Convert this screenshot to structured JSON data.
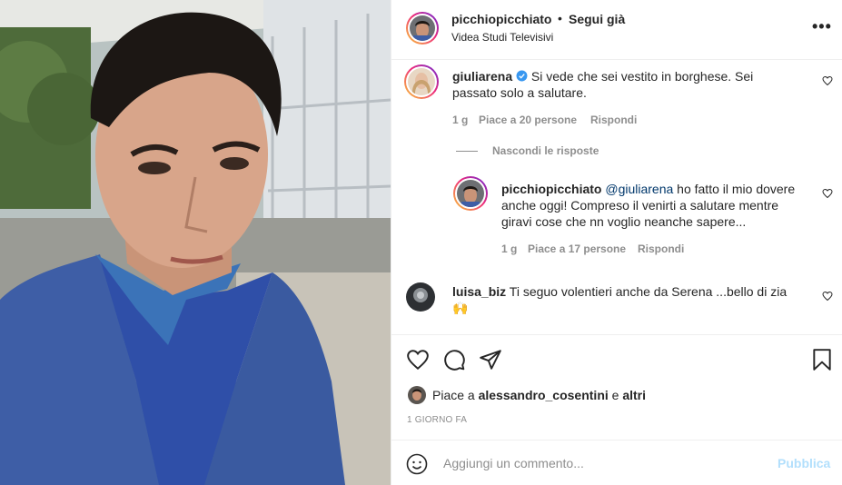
{
  "header": {
    "username": "picchiopicchiato",
    "dot": "•",
    "follow_label": "Segui già",
    "location": "Videa Studi Televisivi",
    "more": "•••"
  },
  "comments": [
    {
      "username": "giuliarena",
      "verified": true,
      "text_line1": "Si vede che sei vestito in borghese. Sei",
      "text_line2": "passato solo a salutare.",
      "time": "1 g",
      "likes": "Piace a 20 persone",
      "reply": "Rispondi"
    }
  ],
  "hide_replies": "Nascondi le risposte",
  "reply_comment": {
    "username": "picchiopicchiato",
    "mention": "@giuliarena",
    "text_line1": "ho fatto il mio dovere",
    "text_line2": "anche oggi! Compreso il venirti a salutare mentre",
    "text_line3": "giravi cose che nn voglio neanche sapere...",
    "time": "1 g",
    "likes": "Piace a 17 persone",
    "reply": "Rispondi"
  },
  "comment3": {
    "username": "luisa_biz",
    "text_line1": "Ti seguo volentieri anche da Serena ...bello di zia",
    "text_line2": "🙌"
  },
  "likes": {
    "prefix": "Piace a",
    "user": "alessandro_cosentini",
    "conj": "e",
    "others": "altri"
  },
  "timestamp": "1 GIORNO FA",
  "add_comment": {
    "placeholder": "Aggiungi un commento...",
    "publish": "Pubblica"
  },
  "colors": {
    "verified": "#3897f0",
    "mention": "#00376b",
    "publish_disabled": "#b2dffc",
    "meta": "#8e8e8e"
  },
  "icons": [
    "heart-icon",
    "comment-icon",
    "share-icon",
    "bookmark-icon",
    "emoji-icon",
    "more-icon",
    "verified-icon"
  ]
}
